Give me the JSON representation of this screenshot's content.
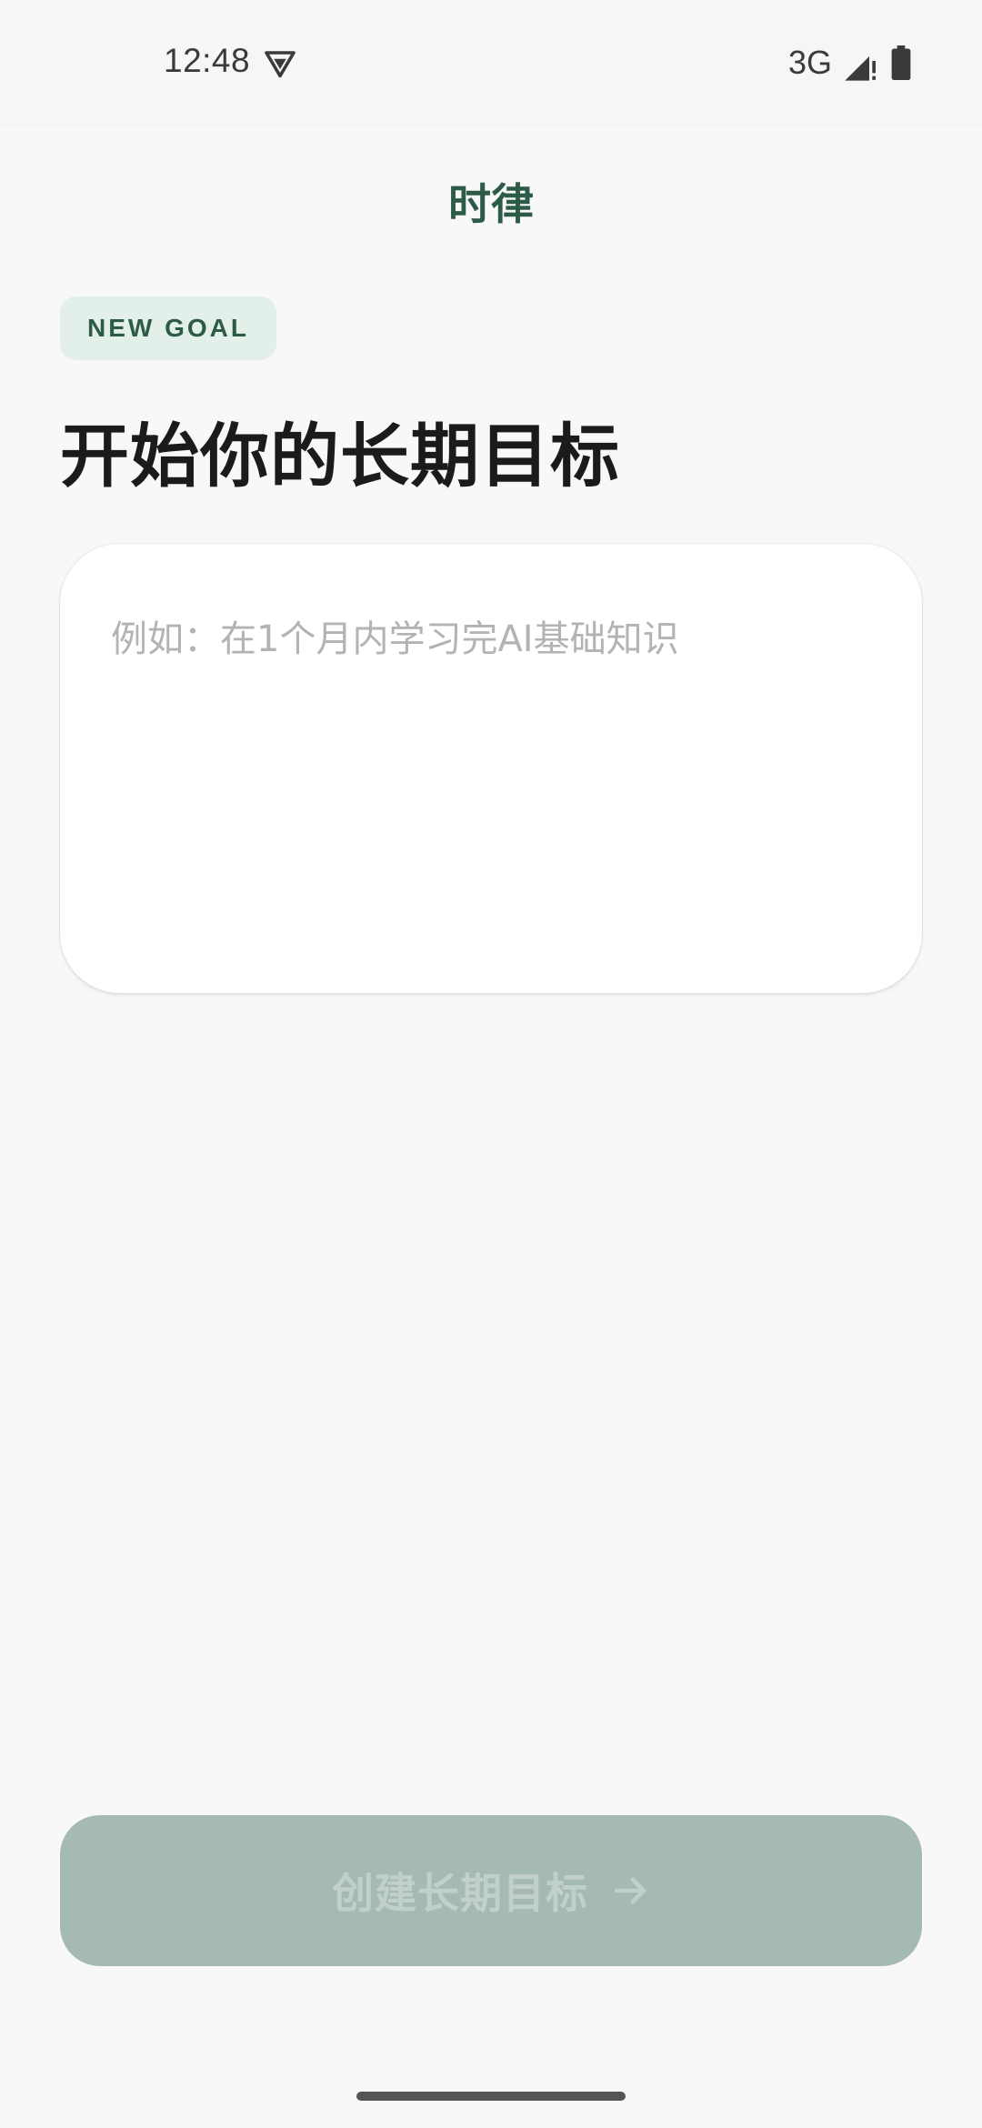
{
  "status_bar": {
    "time": "12:48",
    "network": "3G",
    "icons": [
      "vpn-icon",
      "signal-icon",
      "battery-icon"
    ]
  },
  "app": {
    "title": "时律"
  },
  "badge": {
    "label": "NEW GOAL"
  },
  "heading": "开始你的长期目标",
  "goal_input": {
    "value": "",
    "placeholder": "例如：在1个月内学习完AI基础知识"
  },
  "create_button": {
    "label": "创建长期目标",
    "icon": "arrow-right-icon",
    "enabled": false
  },
  "colors": {
    "accent": "#2c5c47",
    "badge_bg": "#e3efe9",
    "button_disabled_bg": "#a5bab1",
    "background": "#f7f8f7"
  }
}
